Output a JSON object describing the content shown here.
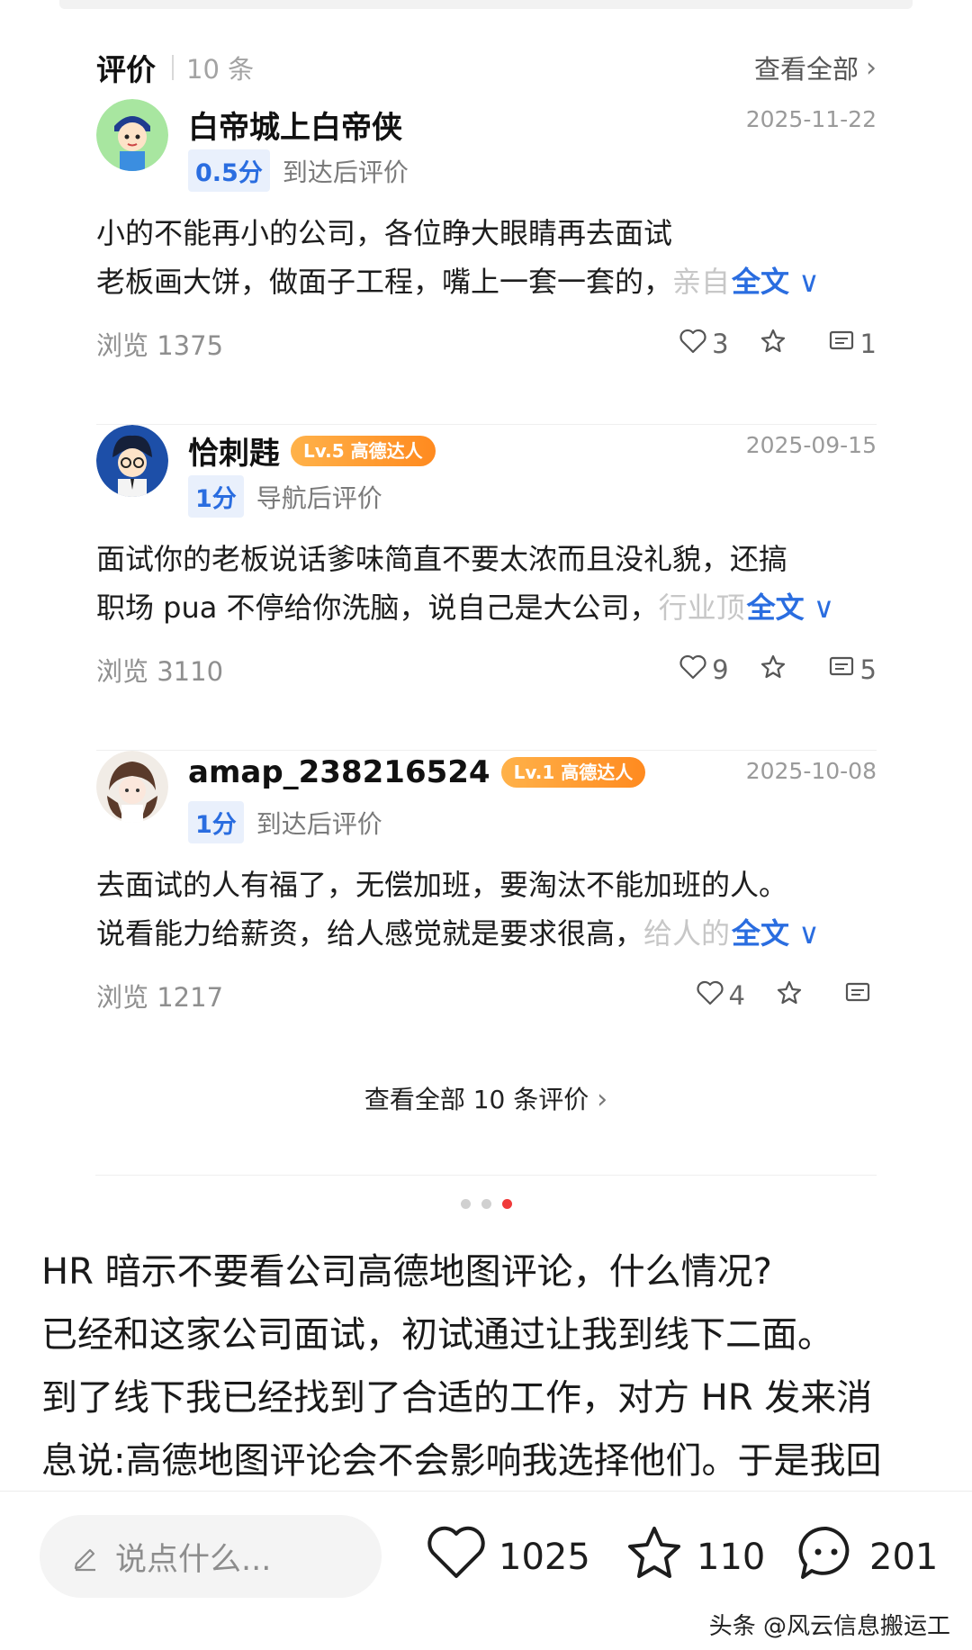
{
  "reviews_header": {
    "title": "评价",
    "count": "10 条",
    "view_all": "查看全部"
  },
  "reviews": [
    {
      "user": "白帝城上白帝侠",
      "badge": "",
      "date": "2025-11-22",
      "score": "0.5分",
      "score_type": "到达后评价",
      "line1": "小的不能再小的公司，各位睁大眼睛再去面试",
      "line2": "老板画大饼，做面子工程，嘴上一套一套的，",
      "line2_fade": "亲自",
      "full_text": "全文",
      "views": "浏览 1375",
      "likes": "3",
      "comments": "1"
    },
    {
      "user": "恰刺韪",
      "badge": "Lv.5 高德达人",
      "date": "2025-09-15",
      "score": "1分",
      "score_type": "导航后评价",
      "line1": "面试你的老板说话爹味简直不要太浓而且没礼貌，还搞",
      "line2": "职场 pua 不停给你洗脑，说自己是大公司，",
      "line2_fade": "行业顶",
      "full_text": "全文",
      "views": "浏览 3110",
      "likes": "9",
      "comments": "5"
    },
    {
      "user": "amap_238216524",
      "badge": "Lv.1 高德达人",
      "date": "2025-10-08",
      "score": "1分",
      "score_type": "到达后评价",
      "line1": "去面试的人有福了，无偿加班，要淘汰不能加班的人。",
      "line2": "说看能力给薪资，给人感觉就是要求很高，",
      "line2_fade": "给人的",
      "full_text": "全文",
      "views": "浏览 1217",
      "likes": "4",
      "comments": ""
    }
  ],
  "see_all_reviews": "查看全部 10 条评价",
  "carousel": {
    "total": 3,
    "active_index": 2
  },
  "post_lines": [
    "HR 暗示不要看公司高德地图评论，什么情况?",
    "已经和这家公司面试，初试通过让我到线下二面。",
    "到了线下我已经找到了合适的工作，对方 HR 发来消",
    "息说:高德地图评论会不会影响我选择他们。于是我回"
  ],
  "bottom_bar": {
    "input_placeholder": "说点什么...",
    "likes": "1025",
    "favorites": "110",
    "comments": "201"
  },
  "watermark": "头条 @风云信息搬运工",
  "colors": {
    "accent_blue": "#2a6de0",
    "badge_orange": "#ff9a2e",
    "dot_active": "#f03a3a"
  }
}
